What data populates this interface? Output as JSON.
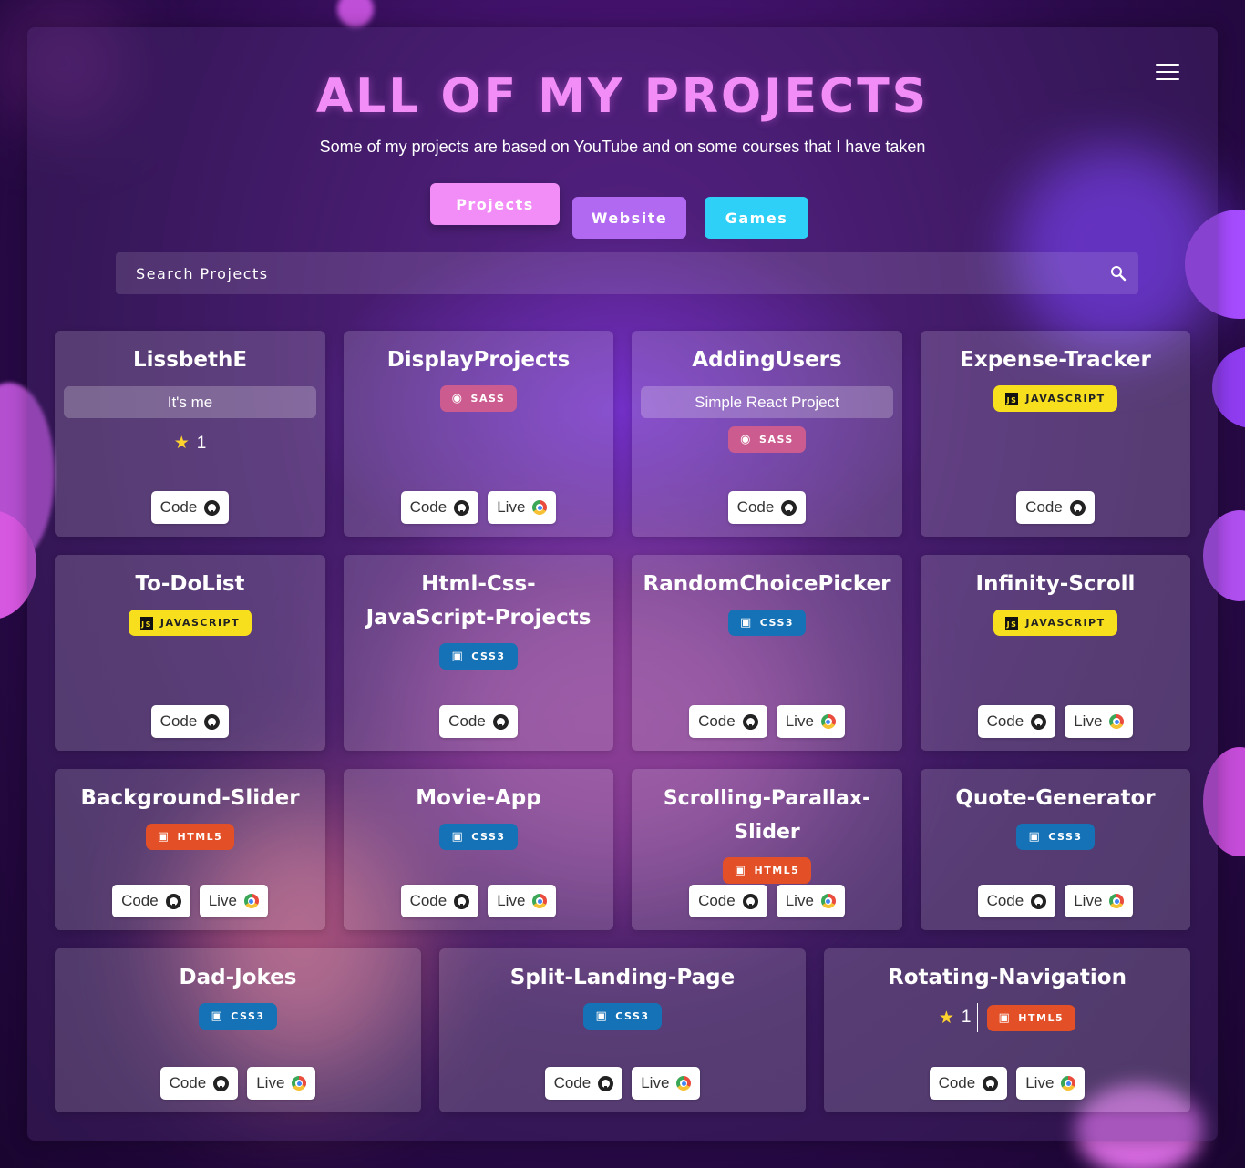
{
  "header": {
    "title": "ALL OF MY PROJECTS",
    "subtitle": "Some of my projects are based on YouTube and on some courses that I have taken",
    "menu_icon": "hamburger-menu-icon"
  },
  "tabs": [
    {
      "label": "Projects",
      "active": true,
      "color": "#f28cf7"
    },
    {
      "label": "Website",
      "active": false,
      "color": "#b069f0"
    },
    {
      "label": "Games",
      "active": false,
      "color": "#2fd0f7"
    }
  ],
  "search": {
    "placeholder": "Search Projects",
    "value": "",
    "icon": "search-icon"
  },
  "buttons": {
    "code": "Code",
    "live": "Live"
  },
  "projects": [
    {
      "name": "LissbethE",
      "description": "It's me",
      "stars": "1",
      "tech": "",
      "live": false
    },
    {
      "name": "DisplayProjects",
      "tech": "SASS",
      "live": true
    },
    {
      "name": "AddingUsers",
      "description": "Simple React Project",
      "tech": "SASS",
      "live": false
    },
    {
      "name": "Expense-Tracker",
      "tech": "JAVASCRIPT",
      "live": false
    },
    {
      "name": "To-DoList",
      "tech": "JAVASCRIPT",
      "live": false
    },
    {
      "name": "Html-Css-JavaScript-Projects",
      "tech": "CSS3",
      "live": false
    },
    {
      "name": "RandomChoicePicker",
      "tech": "CSS3",
      "live": true
    },
    {
      "name": "Infinity-Scroll",
      "tech": "JAVASCRIPT",
      "live": true
    },
    {
      "name": "Background-Slider",
      "tech": "HTML5",
      "live": true
    },
    {
      "name": "Movie-App",
      "tech": "CSS3",
      "live": true
    },
    {
      "name": "Scrolling-Parallax-Slider",
      "tech": "HTML5",
      "live": true
    },
    {
      "name": "Quote-Generator",
      "tech": "CSS3",
      "live": true
    },
    {
      "name": "Dad-Jokes",
      "tech": "CSS3",
      "live": true
    },
    {
      "name": "Split-Landing-Page",
      "tech": "CSS3",
      "live": true
    },
    {
      "name": "Rotating-Navigation",
      "stars": "1",
      "tech": "HTML5",
      "live": true
    }
  ],
  "colors": {
    "title": "#f28cf7",
    "sass": "#cc5c8f",
    "javascript": "#f7df1e",
    "css3": "#1572b6",
    "html5": "#e34f26",
    "star": "#ffd22e"
  }
}
